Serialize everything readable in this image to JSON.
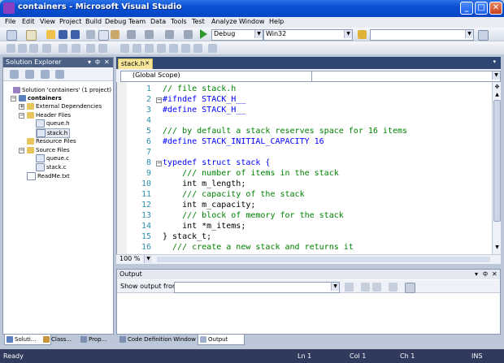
{
  "window": {
    "title": "containers - Microsoft Visual Studio",
    "min": "_",
    "max": "□",
    "close": "✕"
  },
  "menu": [
    "File",
    "Edit",
    "View",
    "Project",
    "Build",
    "Debug",
    "Team",
    "Data",
    "Tools",
    "Test",
    "Analyze",
    "Window",
    "Help"
  ],
  "toolbar": {
    "config": "Debug",
    "platform": "Win32",
    "find": ""
  },
  "solution_explorer": {
    "title": "Solution Explorer",
    "pin": "📌",
    "close": "✕",
    "tree": {
      "solution": "Solution 'containers' (1 project)",
      "project": "containers",
      "external": "External Dependencies",
      "header_files": "Header Files",
      "queue_h": "queue.h",
      "stack_h": "stack.h",
      "resource_files": "Resource Files",
      "source_files": "Source Files",
      "queue_c": "queue.c",
      "stack_c": "stack.c",
      "readme": "ReadMe.txt"
    }
  },
  "editor": {
    "tab": "stack.h",
    "tab_close": "✕",
    "scope": "(Global Scope)",
    "zoom": "100 %",
    "lines": [
      {
        "n": "1",
        "text": "// file stack.h"
      },
      {
        "n": "2",
        "text": "#ifndef STACK_H__"
      },
      {
        "n": "3",
        "text": "#define STACK_H__"
      },
      {
        "n": "4",
        "text": ""
      },
      {
        "n": "5",
        "text": "/// by default a stack reserves space for 16 items"
      },
      {
        "n": "6",
        "text": "#define STACK_INITIAL_CAPACITY 16"
      },
      {
        "n": "7",
        "text": ""
      },
      {
        "n": "8",
        "text": "typedef struct stack {"
      },
      {
        "n": "9",
        "text": "    /// number of items in the stack"
      },
      {
        "n": "10",
        "text": "    int m_length;"
      },
      {
        "n": "11",
        "text": "    /// capacity of the stack"
      },
      {
        "n": "12",
        "text": "    int m_capacity;"
      },
      {
        "n": "13",
        "text": "    /// block of memory for the stack"
      },
      {
        "n": "14",
        "text": "    int *m_items;"
      },
      {
        "n": "15",
        "text": "} stack_t;"
      },
      {
        "n": "16",
        "text": "  /// create a new stack and returns it"
      }
    ]
  },
  "output": {
    "title": "Output",
    "show_label": "Show output from:",
    "value": ""
  },
  "bottom_tabs_left": [
    "Soluti...",
    "Class...",
    "Prop..."
  ],
  "bottom_tabs_right": [
    "Code Definition Window",
    "Output"
  ],
  "status": {
    "ready": "Ready",
    "ln": "Ln 1",
    "col": "Col 1",
    "ch": "Ch 1",
    "ins": "INS"
  }
}
